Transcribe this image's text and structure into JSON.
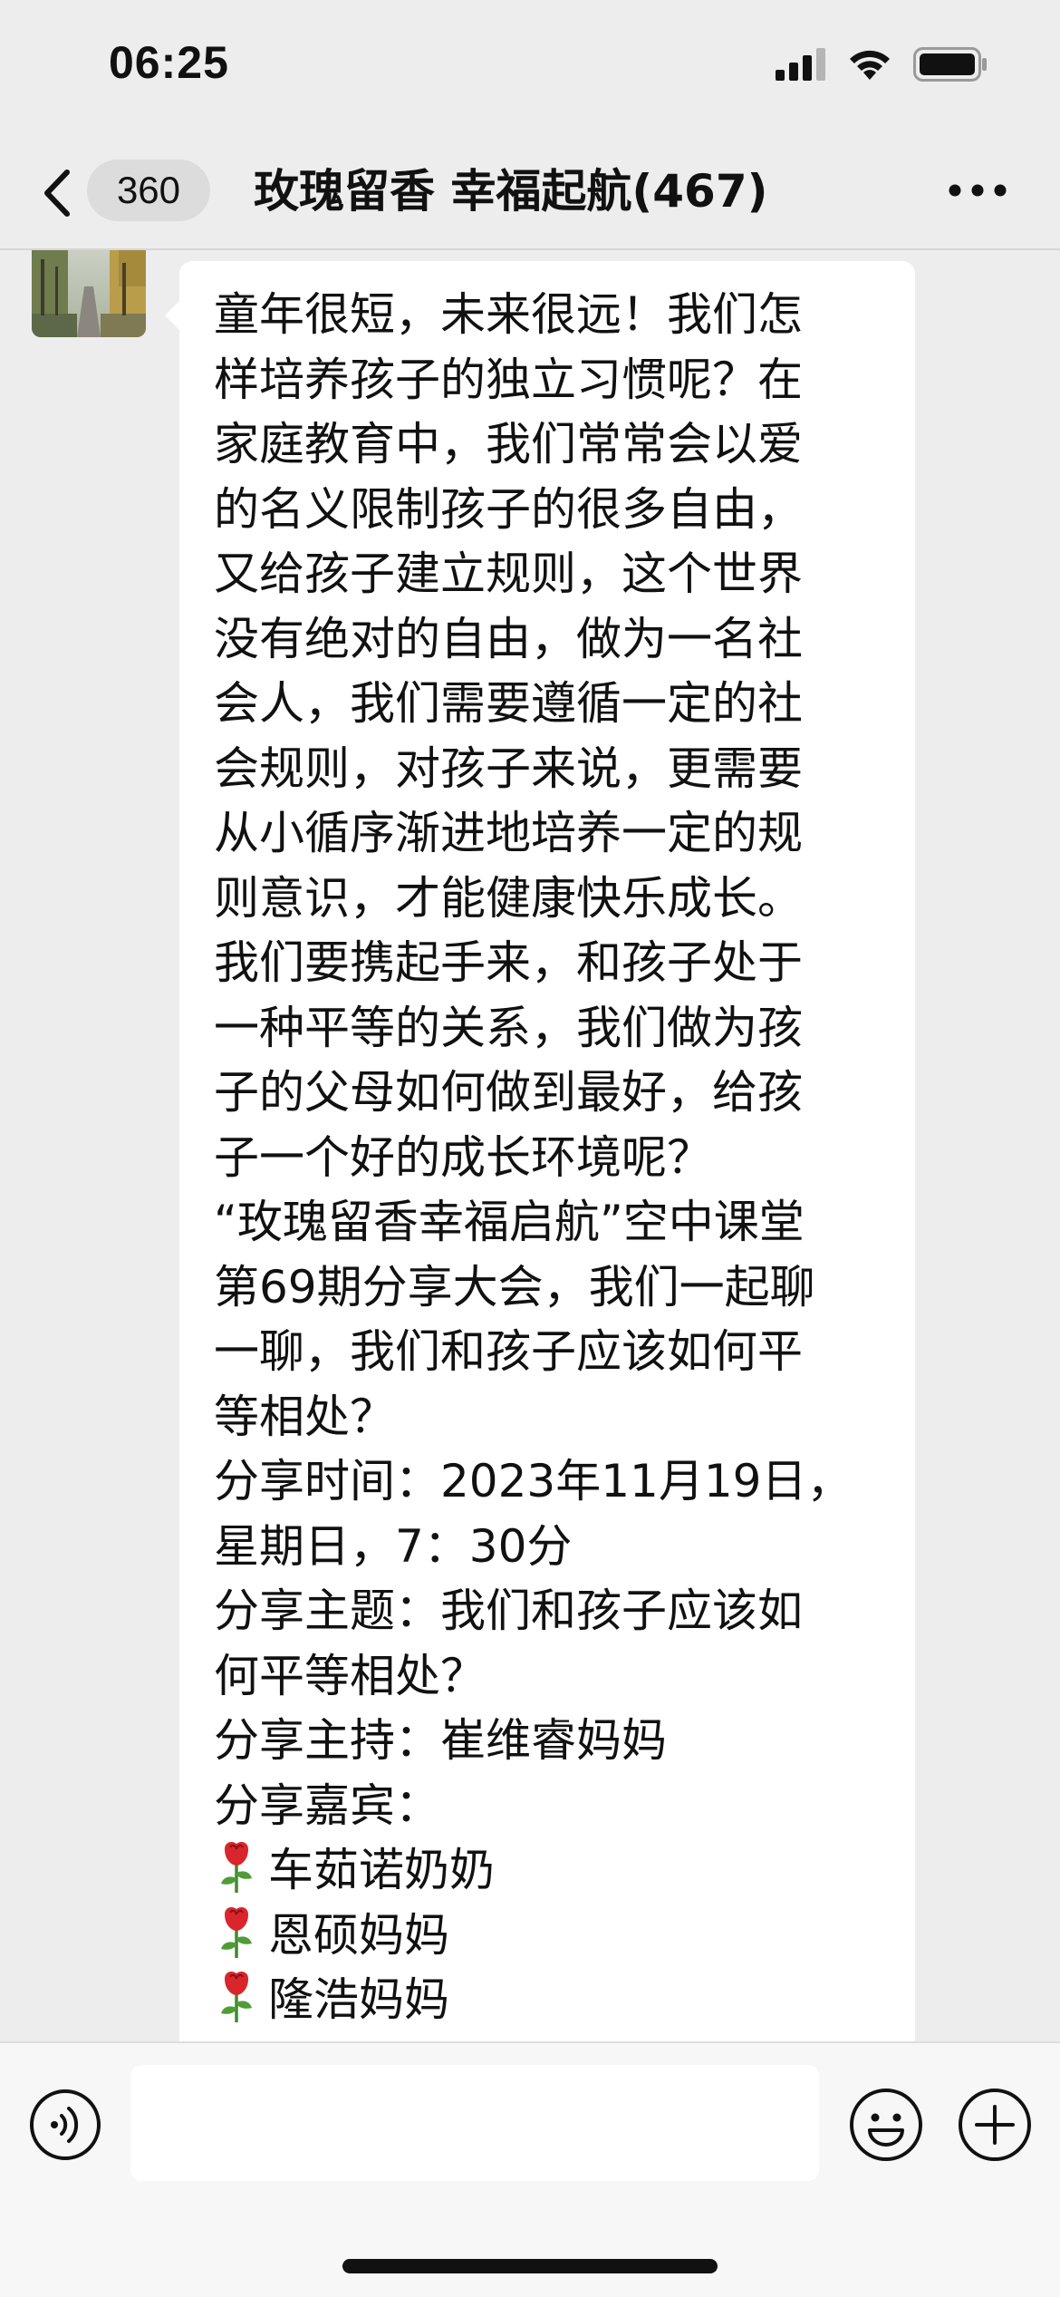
{
  "status_bar": {
    "time": "06:25",
    "icons": [
      "cellular-signal-icon",
      "wifi-icon",
      "battery-icon"
    ]
  },
  "nav": {
    "back_icon": "chevron-left-icon",
    "unread_count": "360",
    "title": "玫瑰留香  幸福起航(467)",
    "more_icon": "more-dots-icon"
  },
  "message": {
    "lines": [
      "童年很短，未来很远！我们怎",
      "样培养孩子的独立习惯呢？在",
      "家庭教育中，我们常常会以爱",
      "的名义限制孩子的很多自由，",
      "又给孩子建立规则，这个世界",
      "没有绝对的自由，做为一名社",
      "会人，我们需要遵循一定的社",
      "会规则，对孩子来说，更需要",
      "从小循序渐进地培养一定的规",
      "则意识，才能健康快乐成长。",
      "我们要携起手来，和孩子处于",
      "一种平等的关系，我们做为孩",
      "子的父母如何做到最好，给孩",
      "子一个好的成长环境呢？",
      "“玫瑰留香幸福启航”空中课堂",
      "第69期分享大会，我们一起聊",
      "一聊，我们和孩子应该如何平",
      "等相处？",
      "分享时间：2023年11月19日，",
      "星期日，7：30分",
      "分享主题：我们和孩子应该如",
      "何平等相处？",
      "分享主持：崔维睿妈妈",
      "分享嘉宾："
    ],
    "guests": [
      "车茹诺奶奶",
      "恩硕妈妈",
      "隆浩妈妈"
    ],
    "guest_icon": "rose-icon"
  },
  "input_bar": {
    "voice_icon": "voice-icon",
    "input_value": "",
    "emoji_icon": "emoji-icon",
    "plus_icon": "plus-icon"
  }
}
